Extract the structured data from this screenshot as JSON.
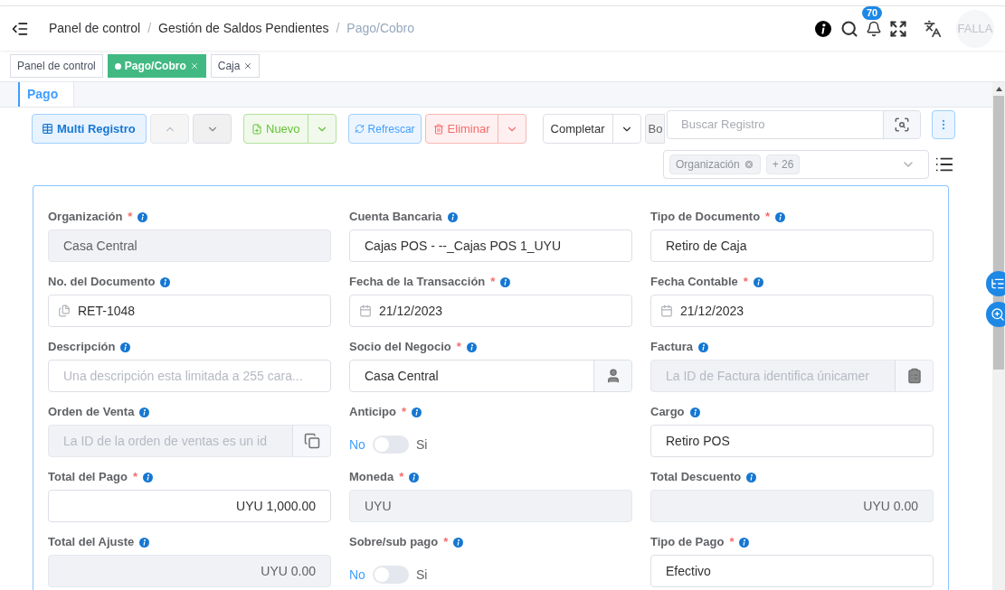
{
  "breadcrumb": {
    "items": [
      "Panel de control",
      "Gestión de Saldos Pendientes",
      "Pago/Cobro"
    ],
    "separator": "/"
  },
  "required_mark": "*",
  "header": {
    "notifications": "70",
    "avatar": "FALLA"
  },
  "tabs": [
    {
      "label": "Panel de control",
      "selected": false,
      "closable": false
    },
    {
      "label": "Pago/Cobro",
      "selected": true,
      "closable": true
    },
    {
      "label": "Caja",
      "selected": false,
      "closable": true
    }
  ],
  "subtabs": [
    {
      "label": "Pago",
      "selected": true
    }
  ],
  "toolbar": {
    "multi": "Multi Registro",
    "new": "Nuevo",
    "refresh": "Refrescar",
    "delete": "Eliminar",
    "action": "Completar",
    "hidden_button": "Bo",
    "search": {
      "placeholder": "Buscar Registro"
    },
    "filter_chips": [
      "Organización",
      "+ 26"
    ]
  },
  "fields": [
    {
      "kind": "text",
      "label": "Organización",
      "required": true,
      "disabled": true,
      "value": "Casa Central"
    },
    {
      "kind": "text",
      "label": "Cuenta Bancaria",
      "required": false,
      "disabled": false,
      "value": "Cajas POS - --_Cajas POS 1_UYU"
    },
    {
      "kind": "text",
      "label": "Tipo de Documento",
      "required": true,
      "disabled": false,
      "value": "Retiro de Caja"
    },
    {
      "kind": "docno",
      "label": "No. del Documento",
      "required": false,
      "disabled": false,
      "value": "RET-1048"
    },
    {
      "kind": "date",
      "label": "Fecha de la Transacción",
      "required": true,
      "disabled": false,
      "value": "21/12/2023"
    },
    {
      "kind": "date",
      "label": "Fecha Contable",
      "required": true,
      "disabled": false,
      "value": "21/12/2023"
    },
    {
      "kind": "text",
      "label": "Descripción",
      "required": false,
      "disabled": false,
      "placeholder": "Una descripción esta limitada a 255 cara..."
    },
    {
      "kind": "userlookup",
      "label": "Socio del Negocio",
      "required": true,
      "disabled": false,
      "value": "Casa Central"
    },
    {
      "kind": "cliplookup",
      "label": "Factura",
      "required": false,
      "disabled": true,
      "placeholder": "La ID de Factura identifica únicamer"
    },
    {
      "kind": "copylookup",
      "label": "Orden de Venta",
      "required": false,
      "disabled": true,
      "placeholder": "La ID de la orden de ventas es un id"
    },
    {
      "kind": "toggle",
      "label": "Anticipo",
      "required": true,
      "on": false,
      "off_label": "No",
      "on_label": "Si"
    },
    {
      "kind": "text",
      "label": "Cargo",
      "required": false,
      "disabled": false,
      "value": "Retiro POS"
    },
    {
      "kind": "amount",
      "label": "Total del Pago",
      "required": true,
      "disabled": false,
      "value": "UYU 1,000.00"
    },
    {
      "kind": "text",
      "label": "Moneda",
      "required": true,
      "disabled": true,
      "value": "UYU"
    },
    {
      "kind": "amount",
      "label": "Total Descuento",
      "required": false,
      "disabled": true,
      "value": "UYU 0.00"
    },
    {
      "kind": "amount",
      "label": "Total del Ajuste",
      "required": false,
      "disabled": true,
      "value": "UYU 0.00"
    },
    {
      "kind": "toggle",
      "label": "Sobre/sub pago",
      "required": true,
      "on": false,
      "off_label": "No",
      "on_label": "Si"
    },
    {
      "kind": "text",
      "label": "Tipo de Pago",
      "required": true,
      "disabled": false,
      "value": "Efectivo"
    }
  ]
}
